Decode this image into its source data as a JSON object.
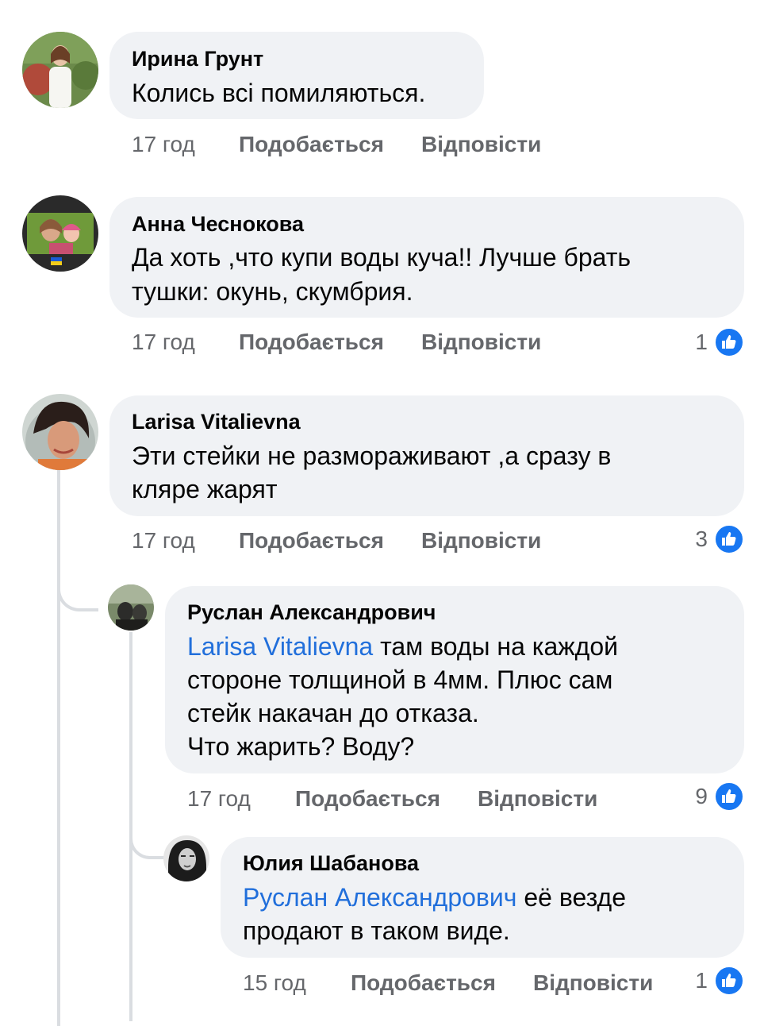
{
  "colors": {
    "bubble": "#f0f2f5",
    "mention": "#216fdb",
    "meta": "#65676b",
    "like": "#1877f2",
    "thread_line": "#dadde1"
  },
  "comments": [
    {
      "author": "Ирина Грунт",
      "lines": [
        "Колись всі помиляються."
      ],
      "time": "17 год",
      "like_label": "Подобається",
      "reply_label": "Відповісти",
      "reactions": ""
    },
    {
      "author": "Анна Чеснокова",
      "lines": [
        "Да хоть ,что купи воды куча!! Лучше брать",
        "тушки: окунь, скумбрия."
      ],
      "time": "17 год",
      "like_label": "Подобається",
      "reply_label": "Відповісти",
      "reactions": "1",
      "reaction_icon": "like-icon"
    },
    {
      "author": "Larisa Vitalievna",
      "lines": [
        "Эти стейки не размораживают ,а сразу в",
        "кляре жарят"
      ],
      "time": "17 год",
      "like_label": "Подобається",
      "reply_label": "Відповісти",
      "reactions": "3",
      "reaction_icon": "like-icon"
    },
    {
      "author": "Руслан Александрович",
      "mention": "Larisa Vitalievna",
      "first_line_rest": " там воды на каждой",
      "lines": [
        "стороне толщиной в 4мм. Плюс сам",
        "стейк накачан до отказа.",
        "Что жарить? Воду?"
      ],
      "time": "17 год",
      "like_label": "Подобається",
      "reply_label": "Відповісти",
      "reactions": "9",
      "reaction_icon": "like-icon"
    },
    {
      "author": "Юлия Шабанова",
      "mention": "Руслан Александрович",
      "first_line_rest": " её везде",
      "lines": [
        "продают в таком виде."
      ],
      "time": "15 год",
      "like_label": "Подобається",
      "reply_label": "Відповісти",
      "reactions": "1",
      "reaction_icon": "like-icon"
    }
  ]
}
